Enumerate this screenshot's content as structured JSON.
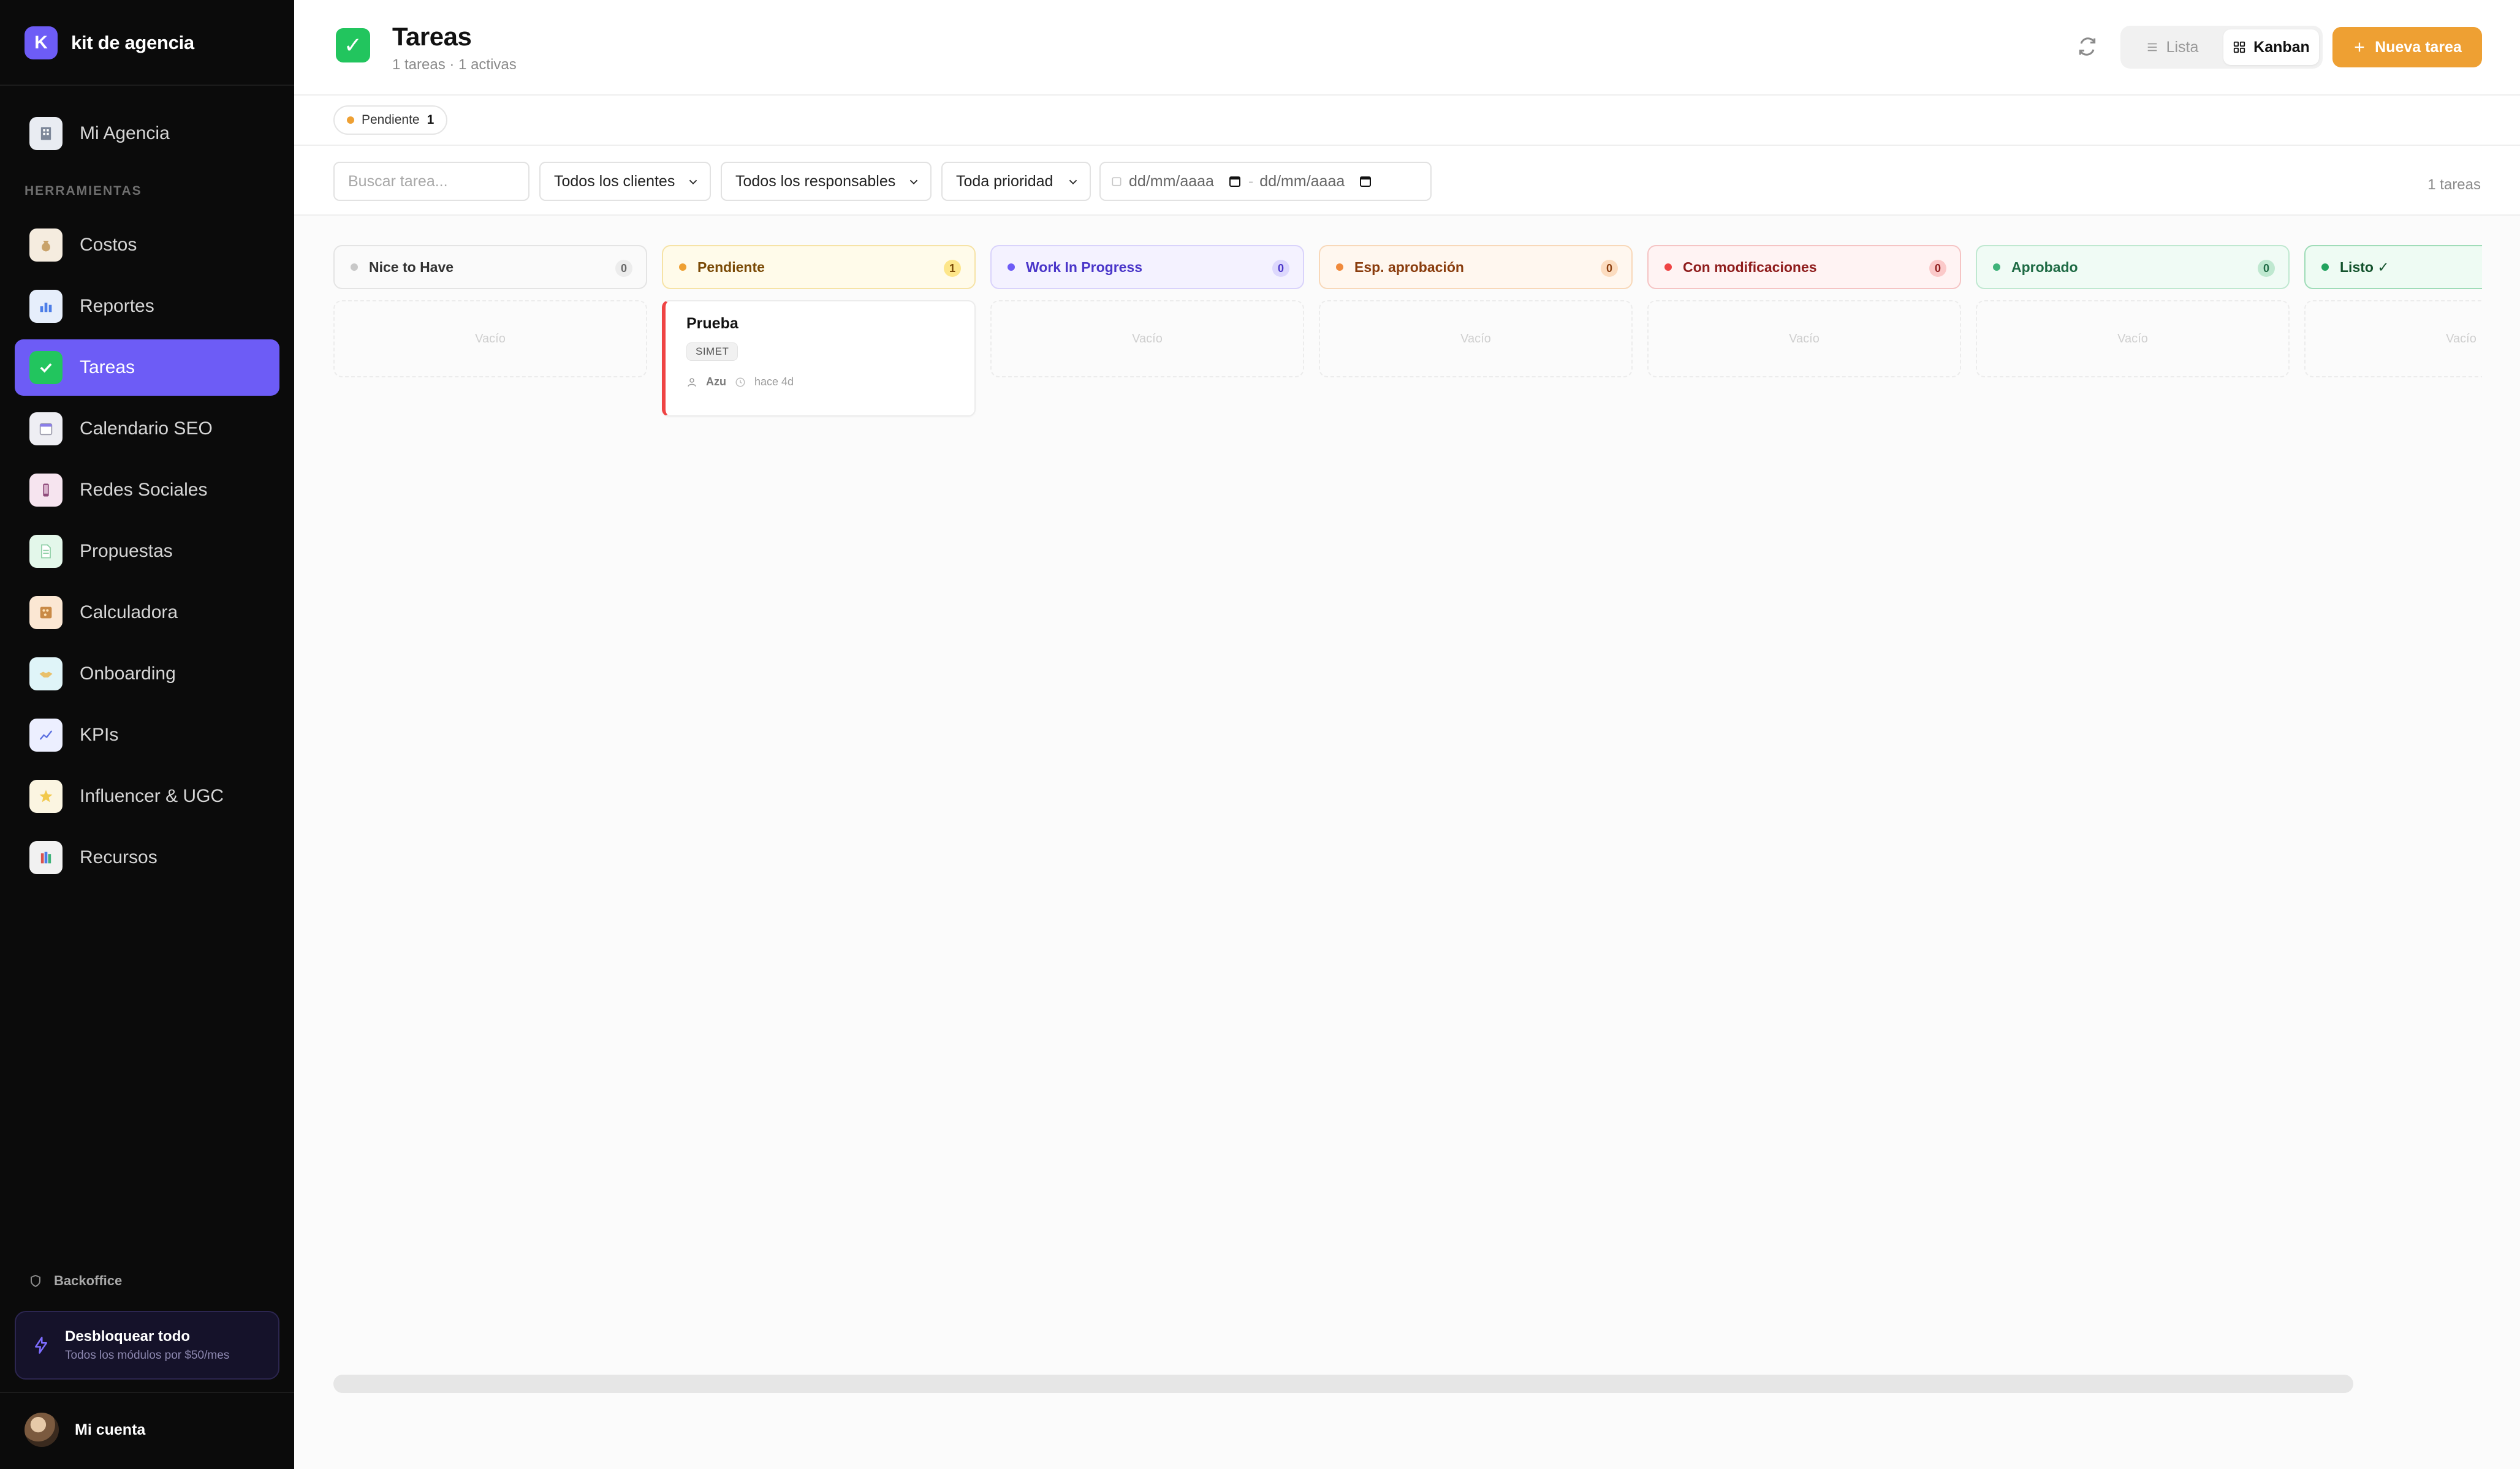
{
  "brand": {
    "initial": "K",
    "name": "kit de agencia",
    "color": "#6d5cf6"
  },
  "sidebar": {
    "top_item": {
      "label": "Mi Agencia",
      "icon": "building-icon"
    },
    "section_label": "HERRAMIENTAS",
    "items": [
      {
        "label": "Costos",
        "icon": "money-bag-icon",
        "active": false
      },
      {
        "label": "Reportes",
        "icon": "bar-chart-icon",
        "active": false
      },
      {
        "label": "Tareas",
        "icon": "check-box-icon",
        "active": true
      },
      {
        "label": "Calendario SEO",
        "icon": "calendar-icon",
        "active": false
      },
      {
        "label": "Redes Sociales",
        "icon": "mobile-phone-icon",
        "active": false
      },
      {
        "label": "Propuestas",
        "icon": "document-icon",
        "active": false
      },
      {
        "label": "Calculadora",
        "icon": "abacus-icon",
        "active": false
      },
      {
        "label": "Onboarding",
        "icon": "handshake-icon",
        "active": false
      },
      {
        "label": "KPIs",
        "icon": "trend-chart-icon",
        "active": false
      },
      {
        "label": "Influencer & UGC",
        "icon": "star-icon",
        "active": false
      },
      {
        "label": "Recursos",
        "icon": "books-icon",
        "active": false
      }
    ],
    "backoffice": "Backoffice",
    "unlock": {
      "title": "Desbloquear todo",
      "subtitle": "Todos los módulos por $50/mes"
    },
    "account": "Mi cuenta"
  },
  "header": {
    "title": "Tareas",
    "subtitle": "1 tareas · 1 activas",
    "view_list": "Lista",
    "view_kanban": "Kanban",
    "active_view": "Kanban",
    "new_task": "Nueva tarea",
    "accent": "#eea033"
  },
  "status_chips": [
    {
      "label": "Pendiente",
      "count": "1",
      "color": "#eea033"
    }
  ],
  "filters": {
    "search_placeholder": "Buscar tarea...",
    "client": "Todos los clientes",
    "owner": "Todos los responsables",
    "priority": "Toda prioridad",
    "date_from": "dd/mm/aaaa",
    "date_to": "dd/mm/aaaa",
    "total": "1 tareas"
  },
  "columns": [
    {
      "name": "Nice to Have",
      "count": "0",
      "dot": "#c8c8c8",
      "bg": "#fafafa",
      "border": "#e4e4e4",
      "text": "#333333",
      "badge_bg": "#ececec",
      "badge_text": "#666666",
      "empty": "Vacío"
    },
    {
      "name": "Pendiente",
      "count": "1",
      "dot": "#eea033",
      "bg": "#fffbea",
      "border": "#f6e3a6",
      "text": "#7a4a06",
      "badge_bg": "#fde68a",
      "badge_text": "#7a4a06",
      "empty": ""
    },
    {
      "name": "Work In Progress",
      "count": "0",
      "dot": "#6d5cf6",
      "bg": "#f4f2ff",
      "border": "#d9d3fb",
      "text": "#4a36c9",
      "badge_bg": "#ddd8fd",
      "badge_text": "#4a36c9",
      "empty": "Vacío"
    },
    {
      "name": "Esp. aprobación",
      "count": "0",
      "dot": "#f08a3c",
      "bg": "#fff7ef",
      "border": "#f8d8b9",
      "text": "#8a3d0e",
      "badge_bg": "#fcdcbf",
      "badge_text": "#8a3d0e",
      "empty": "Vacío"
    },
    {
      "name": "Con modificaciones",
      "count": "0",
      "dot": "#ef4444",
      "bg": "#fff3f3",
      "border": "#f5c4c4",
      "text": "#8f1d1d",
      "badge_bg": "#fbc9c9",
      "badge_text": "#8f1d1d",
      "empty": "Vacío"
    },
    {
      "name": "Aprobado",
      "count": "0",
      "dot": "#3fb37a",
      "bg": "#f0fbf5",
      "border": "#bfe8d0",
      "text": "#1f6b45",
      "badge_bg": "#bfe8d0",
      "badge_text": "#1f6b45",
      "empty": "Vacío"
    },
    {
      "name": "Listo ✓",
      "count": "",
      "dot": "#22a35e",
      "bg": "#eefbf3",
      "border": "#9fdcb8",
      "text": "#14532d",
      "badge_bg": "#9fdcb8",
      "badge_text": "#14532d",
      "empty": "Vacío"
    }
  ],
  "card": {
    "title": "Prueba",
    "client_tag": "SIMET",
    "assignee": "Azu",
    "age": "hace 4d",
    "priority_color": "#ef4444"
  }
}
